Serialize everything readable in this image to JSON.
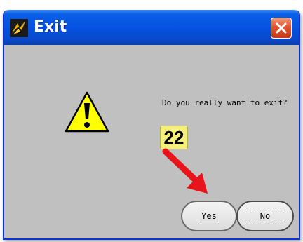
{
  "window": {
    "title": "Exit"
  },
  "dialog": {
    "message": "Do you really want to exit?",
    "step_badge": "22"
  },
  "buttons": {
    "yes_label": "Yes",
    "no_label": "No"
  },
  "icons": {
    "app": "app-logo-icon",
    "close": "close-icon",
    "warning": "warning-icon",
    "pointer": "red-arrow-icon"
  },
  "colors": {
    "titlebar": "#0551e0",
    "dialog_background": "#c0c0c0",
    "close_button": "#e2532f",
    "badge": "#f5f07a",
    "arrow": "#e8141b",
    "warning": "#ffff00"
  }
}
